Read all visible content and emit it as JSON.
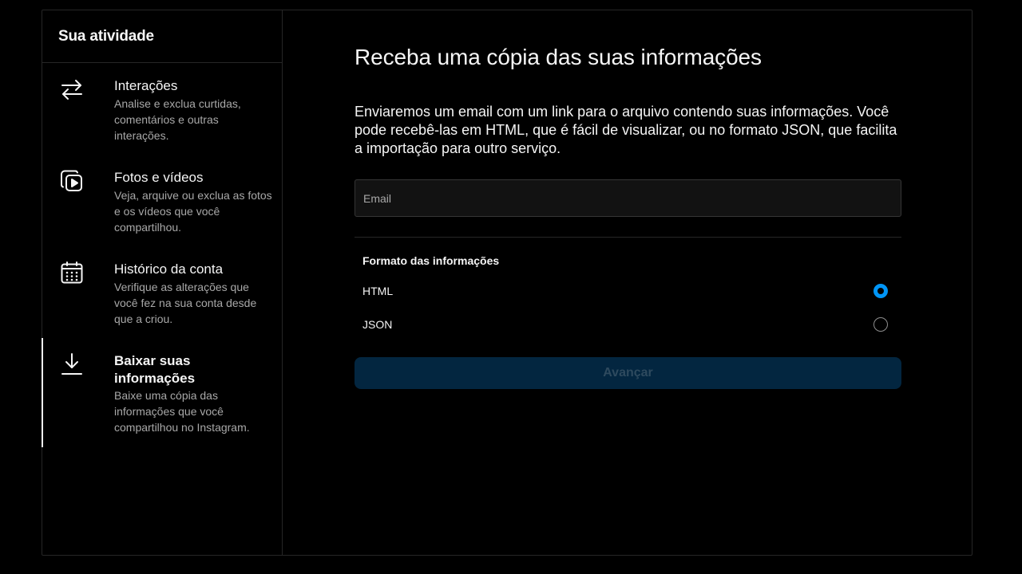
{
  "sidebar": {
    "header": "Sua atividade",
    "items": [
      {
        "icon": "arrows-swap-icon",
        "title": "Interações",
        "description": "Analise e exclua curtidas, comentários e outras interações."
      },
      {
        "icon": "photos-videos-icon",
        "title": "Fotos e vídeos",
        "description": "Veja, arquive ou exclua as fotos e os vídeos que você compartilhou."
      },
      {
        "icon": "calendar-icon",
        "title": "Histórico da conta",
        "description": "Verifique as alterações que você fez na sua conta desde que a criou."
      },
      {
        "icon": "download-icon",
        "title": "Baixar suas informações",
        "description": "Baixe uma cópia das informações que você compartilhou no Instagram.",
        "active": true
      }
    ]
  },
  "main": {
    "title": "Receba uma cópia das suas informações",
    "description": "Enviaremos um email com um link para o arquivo contendo suas informações. Você pode recebê-las em HTML, que é fácil de visualizar, ou no formato JSON, que facilita a importação para outro serviço.",
    "email": {
      "placeholder": "Email",
      "value": ""
    },
    "format": {
      "label": "Formato das informações",
      "options": [
        {
          "label": "HTML",
          "selected": true
        },
        {
          "label": "JSON",
          "selected": false
        }
      ]
    },
    "next_button": "Avançar"
  },
  "colors": {
    "background": "#000000",
    "border": "#262626",
    "text_primary": "#f5f5f5",
    "text_secondary": "#a8a8a8",
    "accent": "#0095f6",
    "button_disabled_bg": "#032640"
  }
}
